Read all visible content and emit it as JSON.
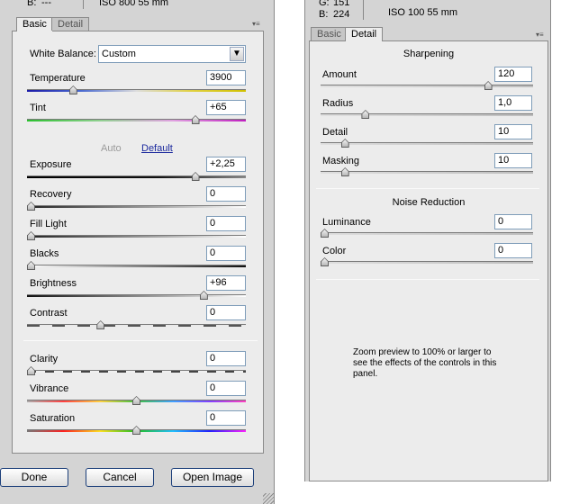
{
  "left": {
    "header": {
      "b_label": "B:",
      "b_value": "---",
      "iso_info": "ISO 800  55 mm"
    },
    "tabs": [
      "Basic",
      "Detail"
    ],
    "white_balance": {
      "label": "White Balance:",
      "value": "Custom"
    },
    "sliders_top": [
      {
        "label": "Temperature",
        "value": "3900",
        "level": 0.2
      },
      {
        "label": "Tint",
        "value": "+65",
        "level": 0.78
      }
    ],
    "auto_label": "Auto",
    "default_label": "Default",
    "sliders_tone": [
      {
        "label": "Exposure",
        "value": "+2,25",
        "level": 0.78
      },
      {
        "label": "Recovery",
        "value": "0",
        "level": 0.0
      },
      {
        "label": "Fill Light",
        "value": "0",
        "level": 0.0
      },
      {
        "label": "Blacks",
        "value": "0",
        "level": 0.0
      },
      {
        "label": "Brightness",
        "value": "+96",
        "level": 0.82
      },
      {
        "label": "Contrast",
        "value": "0",
        "level": 0.33
      }
    ],
    "sliders_presence": [
      {
        "label": "Clarity",
        "value": "0",
        "level": 0.0
      },
      {
        "label": "Vibrance",
        "value": "0",
        "level": 0.5
      },
      {
        "label": "Saturation",
        "value": "0",
        "level": 0.5
      }
    ],
    "buttons": {
      "done": "Done",
      "cancel": "Cancel",
      "open_image": "Open Image"
    }
  },
  "right": {
    "header": {
      "g_label": "G:",
      "g_value": "151",
      "b_label": "B:",
      "b_value": "224",
      "iso_info": "ISO 100   55 mm"
    },
    "tabs": [
      "Basic",
      "Detail"
    ],
    "sharpening_title": "Sharpening",
    "sharpening": [
      {
        "label": "Amount",
        "value": "120",
        "level": 0.8
      },
      {
        "label": "Radius",
        "value": "1,0",
        "level": 0.2
      },
      {
        "label": "Detail",
        "value": "10",
        "level": 0.1
      },
      {
        "label": "Masking",
        "value": "10",
        "level": 0.1
      }
    ],
    "noise_title": "Noise Reduction",
    "noise": [
      {
        "label": "Luminance",
        "value": "0",
        "level": 0.0
      },
      {
        "label": "Color",
        "value": "0",
        "level": 0.0
      }
    ],
    "note": "Zoom preview to 100% or larger to see the effects of the controls in this panel."
  },
  "colors": {
    "link": "#1c2a9e",
    "auto_disabled": "#9a9a9a",
    "button_border": "#1c3f7a"
  },
  "icons": {
    "tab_menu": "panel-menu-icon",
    "dropdown": "chevron-down-icon"
  }
}
